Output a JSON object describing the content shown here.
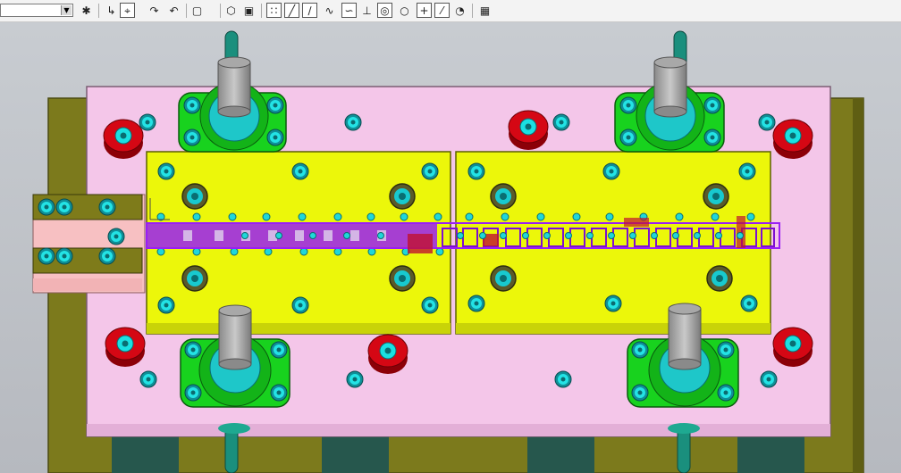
{
  "toolbar": {
    "dropdown_value": "",
    "buttons": [
      {
        "name": "render-icon",
        "glyph": "✱"
      },
      {
        "name": "snap-icon",
        "glyph": "↳"
      },
      {
        "name": "select-icon",
        "glyph": "⌖"
      },
      {
        "name": "rotate-icon",
        "glyph": "↷"
      },
      {
        "name": "pan-icon",
        "glyph": "↶"
      },
      {
        "name": "box-select-icon",
        "glyph": "▢"
      },
      {
        "name": "wireframe-icon",
        "glyph": "⬡"
      },
      {
        "name": "shaded-cube-icon",
        "glyph": "▣"
      },
      {
        "name": "point-icon",
        "glyph": "∷"
      },
      {
        "name": "line-icon",
        "glyph": "╱"
      },
      {
        "name": "arc-line-icon",
        "glyph": "∕"
      },
      {
        "name": "curve-icon",
        "glyph": "∿"
      },
      {
        "name": "spline-icon",
        "glyph": "∽"
      },
      {
        "name": "perpendicular-icon",
        "glyph": "⊥"
      },
      {
        "name": "circle-icon",
        "glyph": "◎"
      },
      {
        "name": "circle-center-icon",
        "glyph": "○"
      },
      {
        "name": "crosshair-icon",
        "glyph": "+"
      },
      {
        "name": "tangent-icon",
        "glyph": "⁄"
      },
      {
        "name": "analysis-icon",
        "glyph": "◔"
      },
      {
        "name": "grid-icon",
        "glyph": "▦"
      }
    ]
  },
  "colors": {
    "base_plate": "#7c7a1c",
    "die_plate": "#f4c6e9",
    "inserts": "#ecf70a",
    "strip": "#9a1ff5",
    "guide_pillar_block": "#18d21e",
    "stop_block": "#cf0712",
    "bolt": "#1fd7d9",
    "feeder": "#f7c0c2",
    "dark_foot": "#26574d",
    "post": "#9b9b9b",
    "rod": "#1a8f7d",
    "background": "#bfc3c9"
  }
}
